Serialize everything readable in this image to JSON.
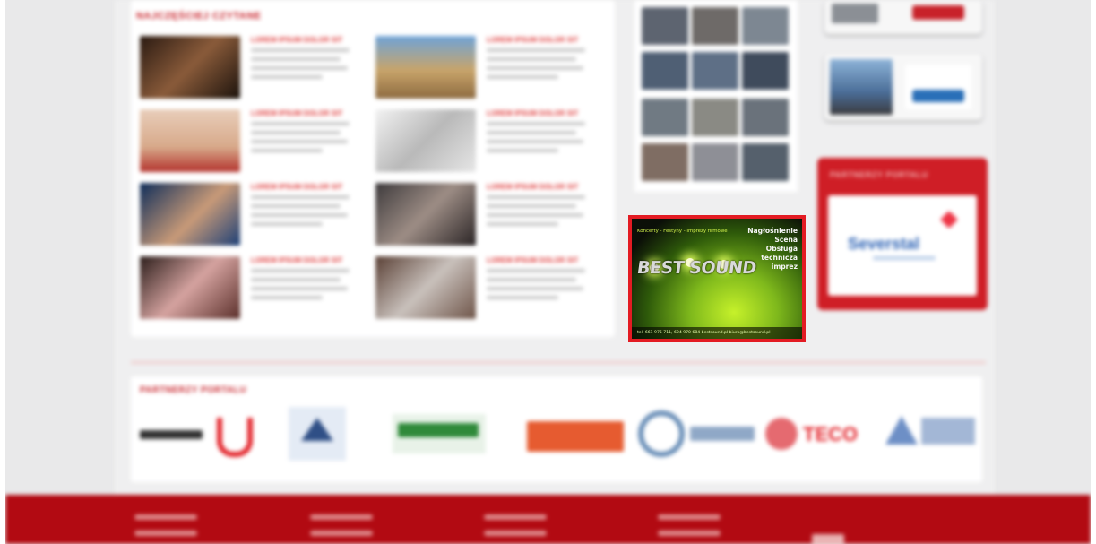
{
  "section_title": "NAJCZĘŚCIEJ CZYTANE",
  "articles": [
    {
      "headline": "LOREM IPSUM DOLOR SIT"
    },
    {
      "headline": "LOREM IPSUM DOLOR SIT"
    },
    {
      "headline": "LOREM IPSUM DOLOR SIT"
    },
    {
      "headline": "LOREM IPSUM DOLOR SIT"
    },
    {
      "headline": "LOREM IPSUM DOLOR SIT"
    },
    {
      "headline": "LOREM IPSUM DOLOR SIT"
    },
    {
      "headline": "LOREM IPSUM DOLOR SIT"
    },
    {
      "headline": "LOREM IPSUM DOLOR SIT"
    }
  ],
  "sidebar_partners": {
    "title": "PARTNERZY PORTALU",
    "logo_text": "Severstal"
  },
  "ad": {
    "top_text": "Koncerty - Festyny - Imprezy firmowe",
    "brand": "BEST SOUND",
    "lines": [
      "Nagłośnienie",
      "Scena",
      "Obsługa",
      "technicza",
      "imprez"
    ],
    "bottom_text": "tel. 661 975 711, 604 970 684   bestsound.pl   biuro@bestsound.pl"
  },
  "partners_strip": {
    "title": "PARTNERZY PORTALU",
    "logos": [
      "",
      "",
      "",
      "",
      "",
      "",
      "TECO",
      ""
    ]
  },
  "footer": {
    "columns": [
      "",
      "",
      "",
      ""
    ]
  },
  "colors": {
    "brand_red": "#c8222a",
    "footer_red": "#b20a12",
    "ad_green": "#c6f12a"
  }
}
